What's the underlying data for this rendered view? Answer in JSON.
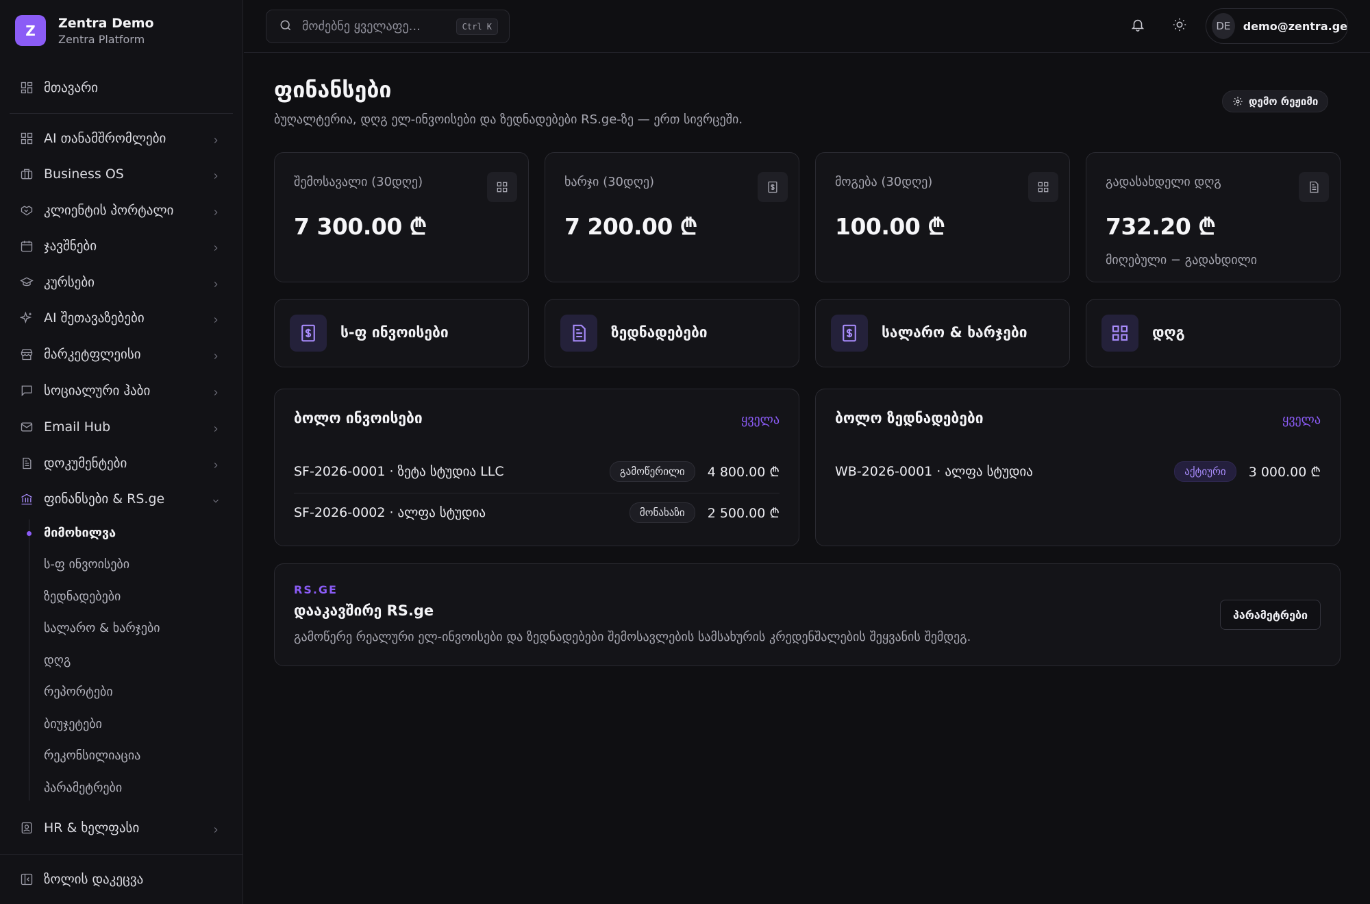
{
  "brand": {
    "logo_letter": "Z",
    "title": "Zentra Demo",
    "subtitle": "Zentra Platform"
  },
  "sidebar": {
    "home": {
      "label": "მთავარი",
      "icon": "dashboard-icon"
    },
    "items": [
      {
        "label": "AI თანამშრომლები",
        "icon": "grid-icon"
      },
      {
        "label": "Business OS",
        "icon": "briefcase-icon"
      },
      {
        "label": "კლიენტის პორტალი",
        "icon": "handshake-icon"
      },
      {
        "label": "ჯავშნები",
        "icon": "calendar-icon"
      },
      {
        "label": "კურსები",
        "icon": "graduation-cap-icon"
      },
      {
        "label": "AI შეთავაზებები",
        "icon": "sparkles-icon"
      },
      {
        "label": "მარკეტფლეისი",
        "icon": "store-icon"
      },
      {
        "label": "სოციალური ჰაბი",
        "icon": "chat-icon"
      },
      {
        "label": "Email Hub",
        "icon": "mail-icon"
      },
      {
        "label": "დოკუმენტები",
        "icon": "document-icon"
      },
      {
        "label": "ფინანსები & RS.ge",
        "icon": "bank-icon"
      }
    ],
    "sub_items": [
      "მიმოხილვა",
      "ს-ფ ინვოისები",
      "ზედნადებები",
      "სალარო & ხარჯები",
      "დღგ",
      "რეპორტები",
      "ბიუჯეტები",
      "რეკონსილიაცია",
      "პარამეტრები"
    ],
    "hr": {
      "label": "HR & ხელფასი",
      "icon": "id-badge-icon"
    },
    "collapse": {
      "label": "ზოლის დაკეცვა",
      "icon": "sidebar-collapse-icon"
    }
  },
  "topbar": {
    "search_placeholder": "მოძებნე ყველაფე...",
    "shortcut": "Ctrl K",
    "user_initials": "DE",
    "user_email": "demo@zentra.ge"
  },
  "page": {
    "title": "ფინანსები",
    "subtitle": "ბუღალტერია, დღგ ელ-ინვოისები და ზედნადებები RS.ge-ზე — ერთ სივრცეში.",
    "demo_badge": "დემო რეჟიმი"
  },
  "stats": [
    {
      "label": "შემოსავალი (30დღე)",
      "value": "7 300.00 ₾",
      "note": "",
      "icon": "grid-icon"
    },
    {
      "label": "ხარჯი (30დღე)",
      "value": "7 200.00 ₾",
      "note": "",
      "icon": "receipt-icon"
    },
    {
      "label": "მოგება (30დღე)",
      "value": "100.00 ₾",
      "note": "",
      "icon": "grid-icon"
    },
    {
      "label": "გადასახდელი დღგ",
      "value": "732.20 ₾",
      "note": "მიღებული − გადახდილი",
      "icon": "document-icon"
    }
  ],
  "quick_actions": [
    {
      "label": "ს-ფ ინვოისები",
      "icon": "receipt-icon"
    },
    {
      "label": "ზედნადებები",
      "icon": "document-icon"
    },
    {
      "label": "სალარო & ხარჯები",
      "icon": "receipt-icon"
    },
    {
      "label": "დღგ",
      "icon": "grid-icon"
    }
  ],
  "recent_invoices": {
    "title": "ბოლო ინვოისები",
    "link": "ყველა",
    "rows": [
      {
        "text": "SF-2026-0001 · ზეტა სტუდია LLC",
        "status": "გამოწერილი",
        "amount": "4 800.00 ₾"
      },
      {
        "text": "SF-2026-0002 · ალფა სტუდია",
        "status": "მონახაზი",
        "amount": "2 500.00 ₾"
      }
    ]
  },
  "recent_waybills": {
    "title": "ბოლო ზედნადებები",
    "link": "ყველა",
    "rows": [
      {
        "text": "WB-2026-0001 · ალფა სტუდია",
        "status": "აქტიური",
        "amount": "3 000.00 ₾"
      }
    ]
  },
  "rsge": {
    "kicker": "RS.GE",
    "title": "დააკავშირე RS.ge",
    "description": "გამოწერე რეალური ელ-ინვოისები და ზედნადებები შემოსავლების სამსახურის კრედენშალების შეყვანის შემდეგ.",
    "button": "პარამეტრები"
  },
  "colors": {
    "accent": "#8b5cf6",
    "background": "#0f0f12",
    "card": "#141418",
    "border": "#2a2a31"
  }
}
